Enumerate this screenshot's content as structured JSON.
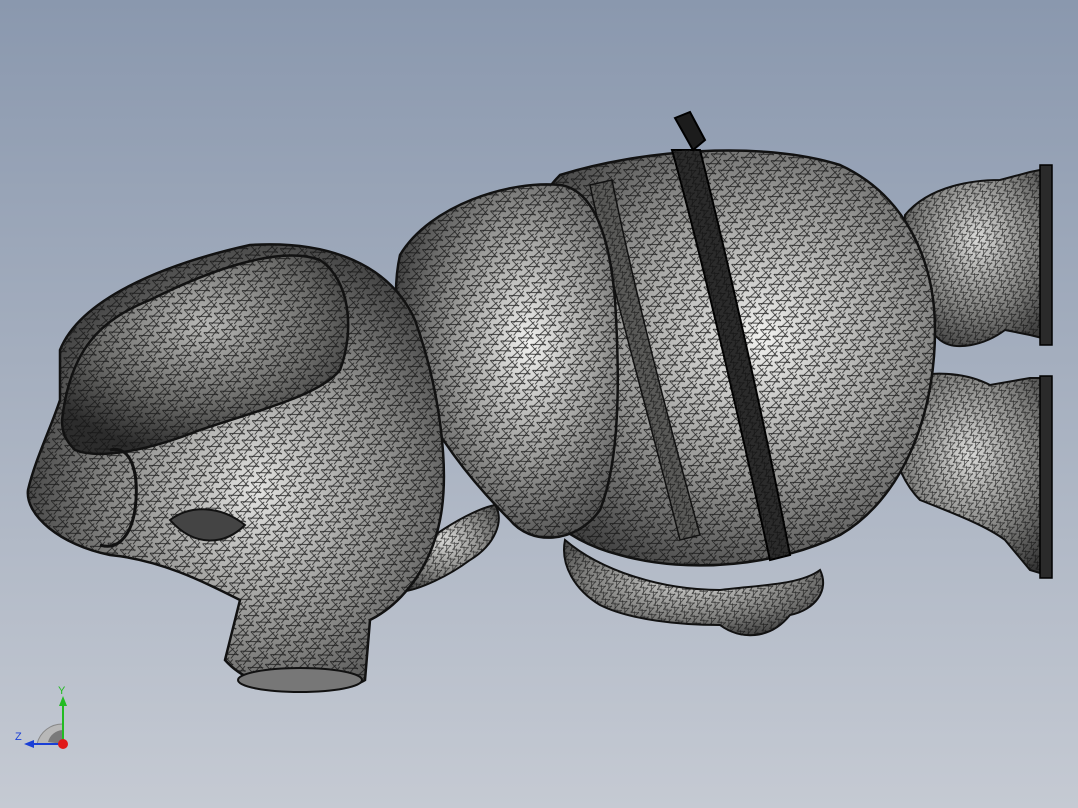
{
  "viewport": {
    "background_top": "#8a98ae",
    "background_bottom": "#c5cad3",
    "model": {
      "name": "mesh-figure",
      "render_mode": "shaded-with-edges",
      "surface_color": "#9a9a9a",
      "edge_color": "#111111"
    }
  },
  "triad": {
    "y_label": "Y",
    "z_label": "Z",
    "y_color": "#22bb22",
    "z_color": "#1a3fd6",
    "x_color": "#e01818"
  }
}
